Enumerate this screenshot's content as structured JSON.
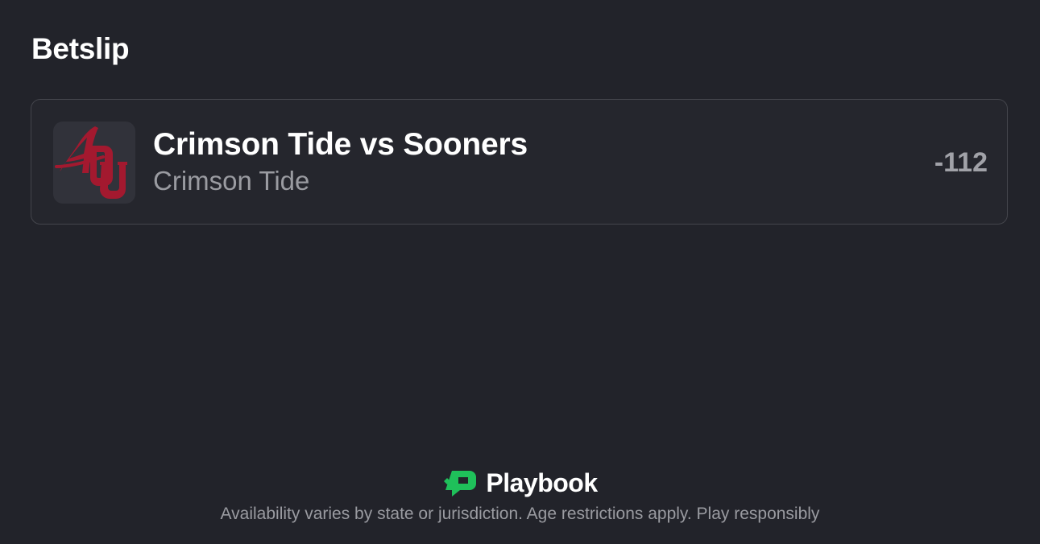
{
  "header": {
    "title": "Betslip"
  },
  "bet": {
    "event": "Crimson Tide vs Sooners",
    "selection": "Crimson Tide",
    "odds": "-112",
    "logo_icon": "team-logos-icon",
    "logo_color": "#a3192f"
  },
  "footer": {
    "brand": "Playbook",
    "brand_icon": "playbook-logo-icon",
    "brand_color": "#1fc05a",
    "disclaimer": "Availability varies by state or jurisdiction. Age restrictions apply. Play responsibly"
  }
}
